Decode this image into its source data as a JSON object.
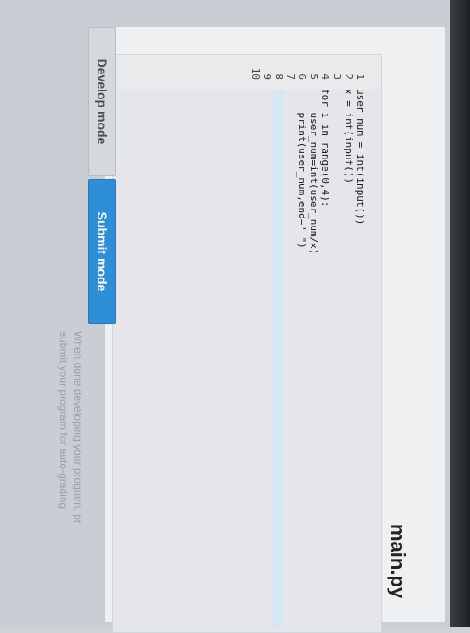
{
  "file": {
    "title": "main.py"
  },
  "editor": {
    "lines": [
      {
        "n": "1",
        "code": "user_num = int(input())"
      },
      {
        "n": "2",
        "code": "x = int(input())"
      },
      {
        "n": "3",
        "code": ""
      },
      {
        "n": "4",
        "code": "for i in range(0,4):"
      },
      {
        "n": "5",
        "code": "    user_num=int(user_num/x)"
      },
      {
        "n": "6",
        "code": "    print(user_num,end=\" \")"
      },
      {
        "n": "7",
        "code": ""
      },
      {
        "n": "8",
        "code": ""
      },
      {
        "n": "9",
        "code": ""
      },
      {
        "n": "10",
        "code": ""
      }
    ]
  },
  "modes": {
    "develop_label": "Develop mode",
    "submit_label": "Submit mode"
  },
  "hint": {
    "line1": "When done developing your program, pr",
    "line2": "submit your program for auto-grading"
  },
  "colors": {
    "accent": "#2f8ed8",
    "editor_bg": "#e4e6e9"
  }
}
